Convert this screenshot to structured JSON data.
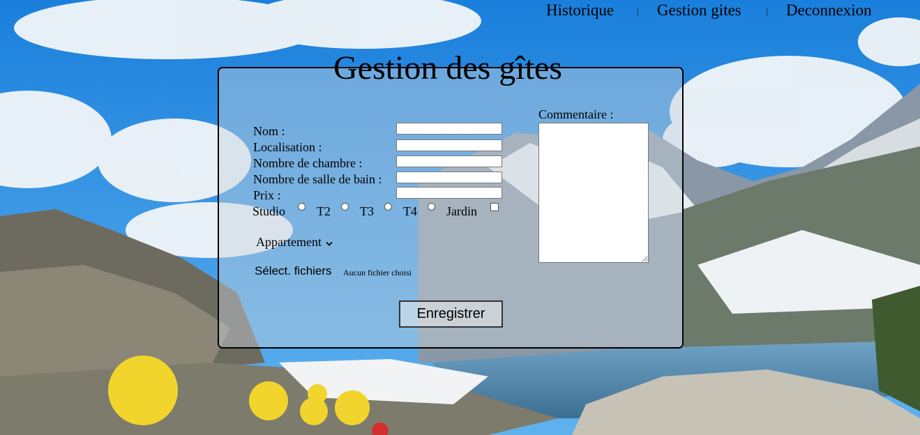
{
  "nav": {
    "items": [
      {
        "label": "Historique"
      },
      {
        "label": "Gestion gites"
      },
      {
        "label": "Deconnexion"
      }
    ],
    "separator": "|"
  },
  "form": {
    "title": "Gestion des gîtes",
    "fields": {
      "nom": {
        "label": "Nom :",
        "value": ""
      },
      "localisation": {
        "label": "Localisation :",
        "value": ""
      },
      "chambres": {
        "label": "Nombre de chambre :",
        "value": ""
      },
      "sdb": {
        "label": "Nombre de salle de bain :",
        "value": ""
      },
      "prix": {
        "label": "Prix :",
        "value": ""
      }
    },
    "types": {
      "studio": "Studio",
      "t2": "T2",
      "t3": "T3",
      "t4": "T4"
    },
    "jardin_label": "Jardin",
    "select": {
      "selected": "Appartement"
    },
    "file": {
      "button": "Sélect. fichiers",
      "status": "Aucun fichier choisi"
    },
    "comment": {
      "label": "Commentaire :",
      "value": ""
    },
    "submit_label": "Enregistrer"
  },
  "colors": {
    "sky": "#2f8fe0",
    "panel_tint": "#c8d2dc",
    "lake": "#5d93b8"
  }
}
